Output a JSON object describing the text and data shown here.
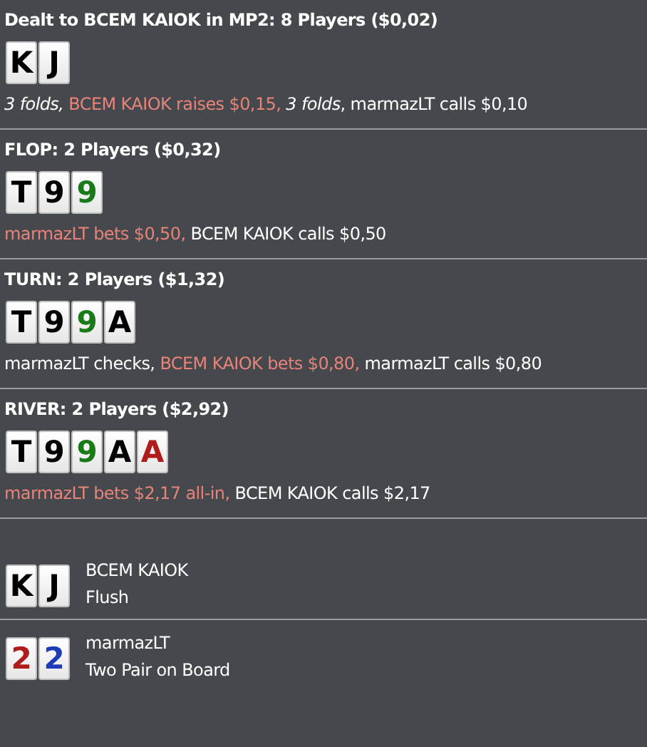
{
  "streets": [
    {
      "title": "Dealt to BCEM KAIOK in MP2: 8 Players ($0,02)",
      "cards": [
        {
          "rank": "K",
          "color": "#000000"
        },
        {
          "rank": "J",
          "color": "#000000"
        }
      ],
      "actions": [
        {
          "text": "3 folds, ",
          "kind": "fold"
        },
        {
          "text": "BCEM KAIOK raises $0,15, ",
          "kind": "hero"
        },
        {
          "text": "3 folds",
          "kind": "fold"
        },
        {
          "text": ", marmazLT calls $0,10",
          "kind": "other"
        }
      ]
    },
    {
      "title": "FLOP: 2 Players ($0,32)",
      "cards": [
        {
          "rank": "T",
          "color": "#000000"
        },
        {
          "rank": "9",
          "color": "#000000"
        },
        {
          "rank": "9",
          "color": "#1a7a1a"
        }
      ],
      "actions": [
        {
          "text": "marmazLT bets $0,50, ",
          "kind": "hero"
        },
        {
          "text": "BCEM KAIOK calls $0,50",
          "kind": "other"
        }
      ]
    },
    {
      "title": "TURN: 2 Players ($1,32)",
      "cards": [
        {
          "rank": "T",
          "color": "#000000"
        },
        {
          "rank": "9",
          "color": "#000000"
        },
        {
          "rank": "9",
          "color": "#1a7a1a"
        },
        {
          "rank": "A",
          "color": "#000000"
        }
      ],
      "actions": [
        {
          "text": "marmazLT checks, ",
          "kind": "other"
        },
        {
          "text": "BCEM KAIOK bets $0,80, ",
          "kind": "hero"
        },
        {
          "text": "marmazLT calls $0,80",
          "kind": "other"
        }
      ]
    },
    {
      "title": "RIVER: 2 Players ($2,92)",
      "cards": [
        {
          "rank": "T",
          "color": "#000000"
        },
        {
          "rank": "9",
          "color": "#000000"
        },
        {
          "rank": "9",
          "color": "#1a7a1a"
        },
        {
          "rank": "A",
          "color": "#000000"
        },
        {
          "rank": "A",
          "color": "#b01c1c"
        }
      ],
      "actions": [
        {
          "text": "marmazLT bets $2,17 all-in, ",
          "kind": "hero"
        },
        {
          "text": "BCEM KAIOK calls $2,17",
          "kind": "other"
        }
      ]
    }
  ],
  "showdown": [
    {
      "player": "BCEM KAIOK",
      "hand": "Flush",
      "cards": [
        {
          "rank": "K",
          "color": "#000000"
        },
        {
          "rank": "J",
          "color": "#000000"
        }
      ]
    },
    {
      "player": "marmazLT",
      "hand": "Two Pair on Board",
      "cards": [
        {
          "rank": "2",
          "color": "#b01c1c"
        },
        {
          "rank": "2",
          "color": "#1c3cb8"
        }
      ]
    }
  ]
}
